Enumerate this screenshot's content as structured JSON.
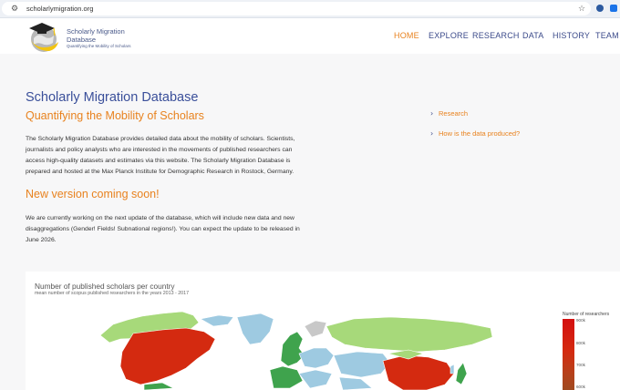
{
  "browser": {
    "url": "scholarlymigration.org",
    "site_info_icon": "tune-icon",
    "bookmark_icon": "star-icon"
  },
  "header": {
    "brand_title": "Scholarly Migration Database",
    "brand_tagline": "Quantifying the Mobility of Scholars",
    "nav": [
      "HOME",
      "EXPLORE",
      "RESEARCH",
      "DATA",
      "HISTORY",
      "TEAM"
    ],
    "active_nav": "HOME"
  },
  "main": {
    "title": "Scholarly Migration Database",
    "subtitle": "Quantifying the Mobility of Scholars",
    "intro_lines": [
      "The Scholarly Migration Database provides detailed data about the mobility of scholars. Scientists,",
      "journalists and policy analysts who are interested in the movements of published researchers can",
      "access high-quality datasets and estimates via this website. The Scholarly Migration Database is",
      "prepared and hosted at the Max Planck Institute for Demographic Research in Rostock, Germany."
    ],
    "news_heading": "New version coming soon!",
    "news_lines": [
      "We are currently working on the next update of the database, which will include new data and new",
      "disaggregations (Gender! Fields! Subnational regions!). You can expect the update to be released in",
      "June 2026."
    ]
  },
  "side_links": [
    "Research",
    "How is the data produced?"
  ],
  "map": {
    "title": "Number of published scholars per country",
    "subtitle": "mean number of scopus published researchers in the years 2013 - 2017",
    "legend_title": "Number of researchers",
    "legend_ticks": [
      "900k",
      "800k",
      "700k",
      "600k"
    ],
    "colors": {
      "high": "#d42a10",
      "mid": "#a7d97a",
      "green": "#3fa34d",
      "blue": "#9ecae1",
      "grey": "#c8c8c8"
    }
  },
  "colors": {
    "accent_orange": "#e8821e",
    "brand_blue": "#3a4f9a"
  }
}
